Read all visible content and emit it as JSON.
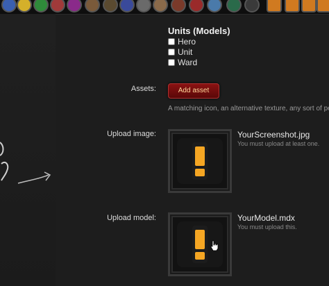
{
  "units": {
    "title": "Units (Models)",
    "options": [
      {
        "label": "Hero",
        "checked": false
      },
      {
        "label": "Unit",
        "checked": false
      },
      {
        "label": "Ward",
        "checked": false
      }
    ]
  },
  "assets": {
    "label": "Assets:",
    "button_label": "Add asset",
    "help_text": "A matching icon, an alternative texture, any sort of pee"
  },
  "upload_image": {
    "label": "Upload image:",
    "file_name": "YourScreenshot.jpg",
    "hint": "You must upload at least one."
  },
  "upload_model": {
    "label": "Upload model:",
    "file_name": "YourModel.mdx",
    "hint": "You must upload this."
  },
  "colors": {
    "background": "#1d1d1d",
    "button": "#8a1212",
    "placeholder_icon": "#f5a623"
  }
}
